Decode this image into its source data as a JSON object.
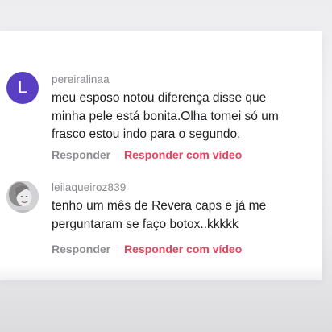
{
  "comments": [
    {
      "avatar_letter": "L",
      "avatar_color": "#5a3fc2",
      "username": "pereiralinaa",
      "text_lines": [
        "meu esposo notou diferença disse que",
        "minha pele está bonita.Olha tomei só um",
        "frasco estou indo para o segundo."
      ],
      "reply_label": "Responder",
      "video_reply_label": "Responder com vídeo"
    },
    {
      "avatar_type": "photo",
      "username": "leilaqueiroz839",
      "text_lines": [
        "tenho um mês de Revera caps e já me",
        "perguntaram se faço botox..kkkkk"
      ],
      "reply_label": "Responder",
      "video_reply_label": "Responder com vídeo"
    }
  ],
  "colors": {
    "video_reply": "#e8435e",
    "reply": "#8c8c91",
    "username": "#8a8a8f",
    "text": "#1e1e22"
  }
}
